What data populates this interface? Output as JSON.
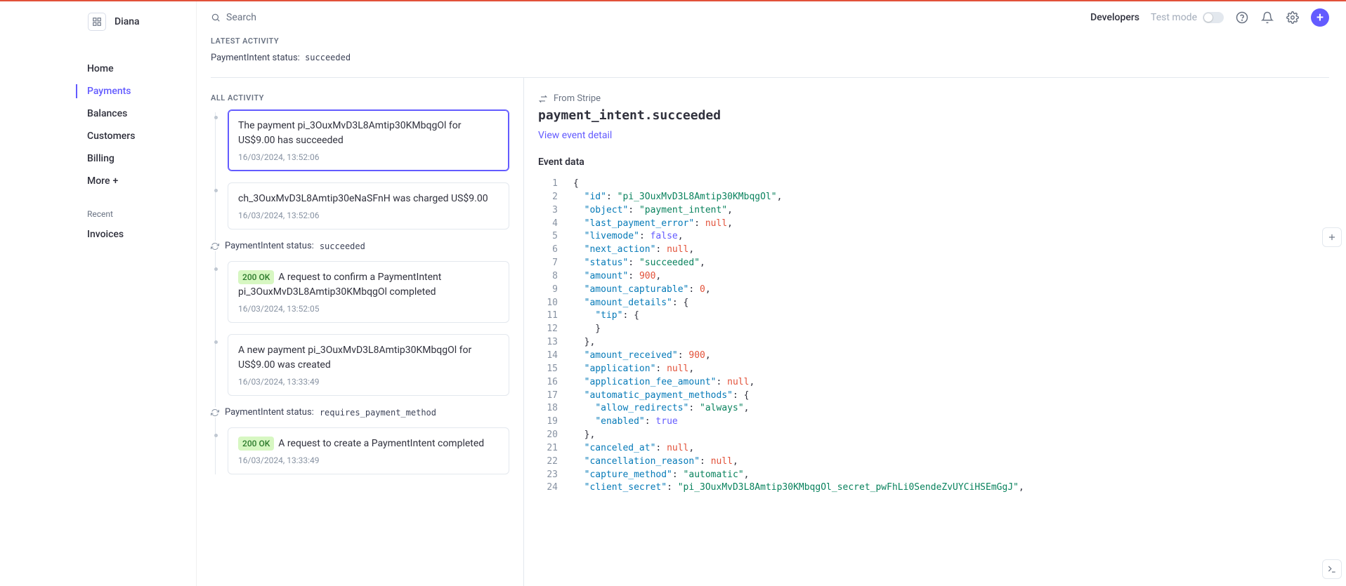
{
  "workspace": {
    "name": "Diana"
  },
  "search": {
    "placeholder": "Search"
  },
  "topbar": {
    "developers": "Developers",
    "test_mode": "Test mode"
  },
  "sidebar": {
    "primary": [
      {
        "label": "Home"
      },
      {
        "label": "Payments"
      },
      {
        "label": "Balances"
      },
      {
        "label": "Customers"
      },
      {
        "label": "Billing"
      }
    ],
    "more": "More",
    "recent_label": "Recent",
    "recent": [
      {
        "label": "Invoices"
      }
    ]
  },
  "latest": {
    "heading": "LATEST ACTIVITY",
    "status_label": "PaymentIntent status:",
    "status_value": "succeeded"
  },
  "all_activity": {
    "heading": "ALL ACTIVITY",
    "items": [
      {
        "kind": "card",
        "selected": true,
        "text": "The payment pi_3OuxMvD3L8Amtip30KMbqgOl for US$9.00 has succeeded",
        "time": "16/03/2024, 13:52:06"
      },
      {
        "kind": "card",
        "text": "ch_3OuxMvD3L8Amtip30eNaSFnH was charged US$9.00",
        "time": "16/03/2024, 13:52:06"
      },
      {
        "kind": "status",
        "label": "PaymentIntent status:",
        "value": "succeeded"
      },
      {
        "kind": "card",
        "badge": "200 OK",
        "text": "A request to confirm a PaymentIntent pi_3OuxMvD3L8Amtip30KMbqgOl completed",
        "time": "16/03/2024, 13:52:05"
      },
      {
        "kind": "card",
        "text": "A new payment pi_3OuxMvD3L8Amtip30KMbqgOl for US$9.00 was created",
        "time": "16/03/2024, 13:33:49"
      },
      {
        "kind": "status",
        "label": "PaymentIntent status:",
        "value": "requires_payment_method"
      },
      {
        "kind": "card",
        "badge": "200 OK",
        "text": "A request to create a PaymentIntent completed",
        "time": "16/03/2024, 13:33:49"
      }
    ]
  },
  "event": {
    "from": "From Stripe",
    "name": "payment_intent.succeeded",
    "link": "View event detail",
    "data_label": "Event data",
    "code": [
      [
        [
          "punc",
          "{"
        ]
      ],
      [
        [
          "punc",
          "  "
        ],
        [
          "key",
          "\"id\""
        ],
        [
          "punc",
          ": "
        ],
        [
          "str",
          "\"pi_3OuxMvD3L8Amtip30KMbqgOl\""
        ],
        [
          "punc",
          ","
        ]
      ],
      [
        [
          "punc",
          "  "
        ],
        [
          "key",
          "\"object\""
        ],
        [
          "punc",
          ": "
        ],
        [
          "str",
          "\"payment_intent\""
        ],
        [
          "punc",
          ","
        ]
      ],
      [
        [
          "punc",
          "  "
        ],
        [
          "key",
          "\"last_payment_error\""
        ],
        [
          "punc",
          ": "
        ],
        [
          "null",
          "null"
        ],
        [
          "punc",
          ","
        ]
      ],
      [
        [
          "punc",
          "  "
        ],
        [
          "key",
          "\"livemode\""
        ],
        [
          "punc",
          ": "
        ],
        [
          "bool",
          "false"
        ],
        [
          "punc",
          ","
        ]
      ],
      [
        [
          "punc",
          "  "
        ],
        [
          "key",
          "\"next_action\""
        ],
        [
          "punc",
          ": "
        ],
        [
          "null",
          "null"
        ],
        [
          "punc",
          ","
        ]
      ],
      [
        [
          "punc",
          "  "
        ],
        [
          "key",
          "\"status\""
        ],
        [
          "punc",
          ": "
        ],
        [
          "str",
          "\"succeeded\""
        ],
        [
          "punc",
          ","
        ]
      ],
      [
        [
          "punc",
          "  "
        ],
        [
          "key",
          "\"amount\""
        ],
        [
          "punc",
          ": "
        ],
        [
          "num",
          "900"
        ],
        [
          "punc",
          ","
        ]
      ],
      [
        [
          "punc",
          "  "
        ],
        [
          "key",
          "\"amount_capturable\""
        ],
        [
          "punc",
          ": "
        ],
        [
          "num",
          "0"
        ],
        [
          "punc",
          ","
        ]
      ],
      [
        [
          "punc",
          "  "
        ],
        [
          "key",
          "\"amount_details\""
        ],
        [
          "punc",
          ": {"
        ]
      ],
      [
        [
          "punc",
          "    "
        ],
        [
          "key",
          "\"tip\""
        ],
        [
          "punc",
          ": {"
        ]
      ],
      [
        [
          "punc",
          "    }"
        ]
      ],
      [
        [
          "punc",
          "  },"
        ]
      ],
      [
        [
          "punc",
          "  "
        ],
        [
          "key",
          "\"amount_received\""
        ],
        [
          "punc",
          ": "
        ],
        [
          "num",
          "900"
        ],
        [
          "punc",
          ","
        ]
      ],
      [
        [
          "punc",
          "  "
        ],
        [
          "key",
          "\"application\""
        ],
        [
          "punc",
          ": "
        ],
        [
          "null",
          "null"
        ],
        [
          "punc",
          ","
        ]
      ],
      [
        [
          "punc",
          "  "
        ],
        [
          "key",
          "\"application_fee_amount\""
        ],
        [
          "punc",
          ": "
        ],
        [
          "null",
          "null"
        ],
        [
          "punc",
          ","
        ]
      ],
      [
        [
          "punc",
          "  "
        ],
        [
          "key",
          "\"automatic_payment_methods\""
        ],
        [
          "punc",
          ": {"
        ]
      ],
      [
        [
          "punc",
          "    "
        ],
        [
          "key",
          "\"allow_redirects\""
        ],
        [
          "punc",
          ": "
        ],
        [
          "str",
          "\"always\""
        ],
        [
          "punc",
          ","
        ]
      ],
      [
        [
          "punc",
          "    "
        ],
        [
          "key",
          "\"enabled\""
        ],
        [
          "punc",
          ": "
        ],
        [
          "bool",
          "true"
        ]
      ],
      [
        [
          "punc",
          "  },"
        ]
      ],
      [
        [
          "punc",
          "  "
        ],
        [
          "key",
          "\"canceled_at\""
        ],
        [
          "punc",
          ": "
        ],
        [
          "null",
          "null"
        ],
        [
          "punc",
          ","
        ]
      ],
      [
        [
          "punc",
          "  "
        ],
        [
          "key",
          "\"cancellation_reason\""
        ],
        [
          "punc",
          ": "
        ],
        [
          "null",
          "null"
        ],
        [
          "punc",
          ","
        ]
      ],
      [
        [
          "punc",
          "  "
        ],
        [
          "key",
          "\"capture_method\""
        ],
        [
          "punc",
          ": "
        ],
        [
          "str",
          "\"automatic\""
        ],
        [
          "punc",
          ","
        ]
      ],
      [
        [
          "punc",
          "  "
        ],
        [
          "key",
          "\"client_secret\""
        ],
        [
          "punc",
          ": "
        ],
        [
          "str",
          "\"pi_3OuxMvD3L8Amtip30KMbqgOl_secret_pwFhLi0SendeZvUYCiHSEmGgJ\""
        ],
        [
          "punc",
          ","
        ]
      ]
    ]
  }
}
